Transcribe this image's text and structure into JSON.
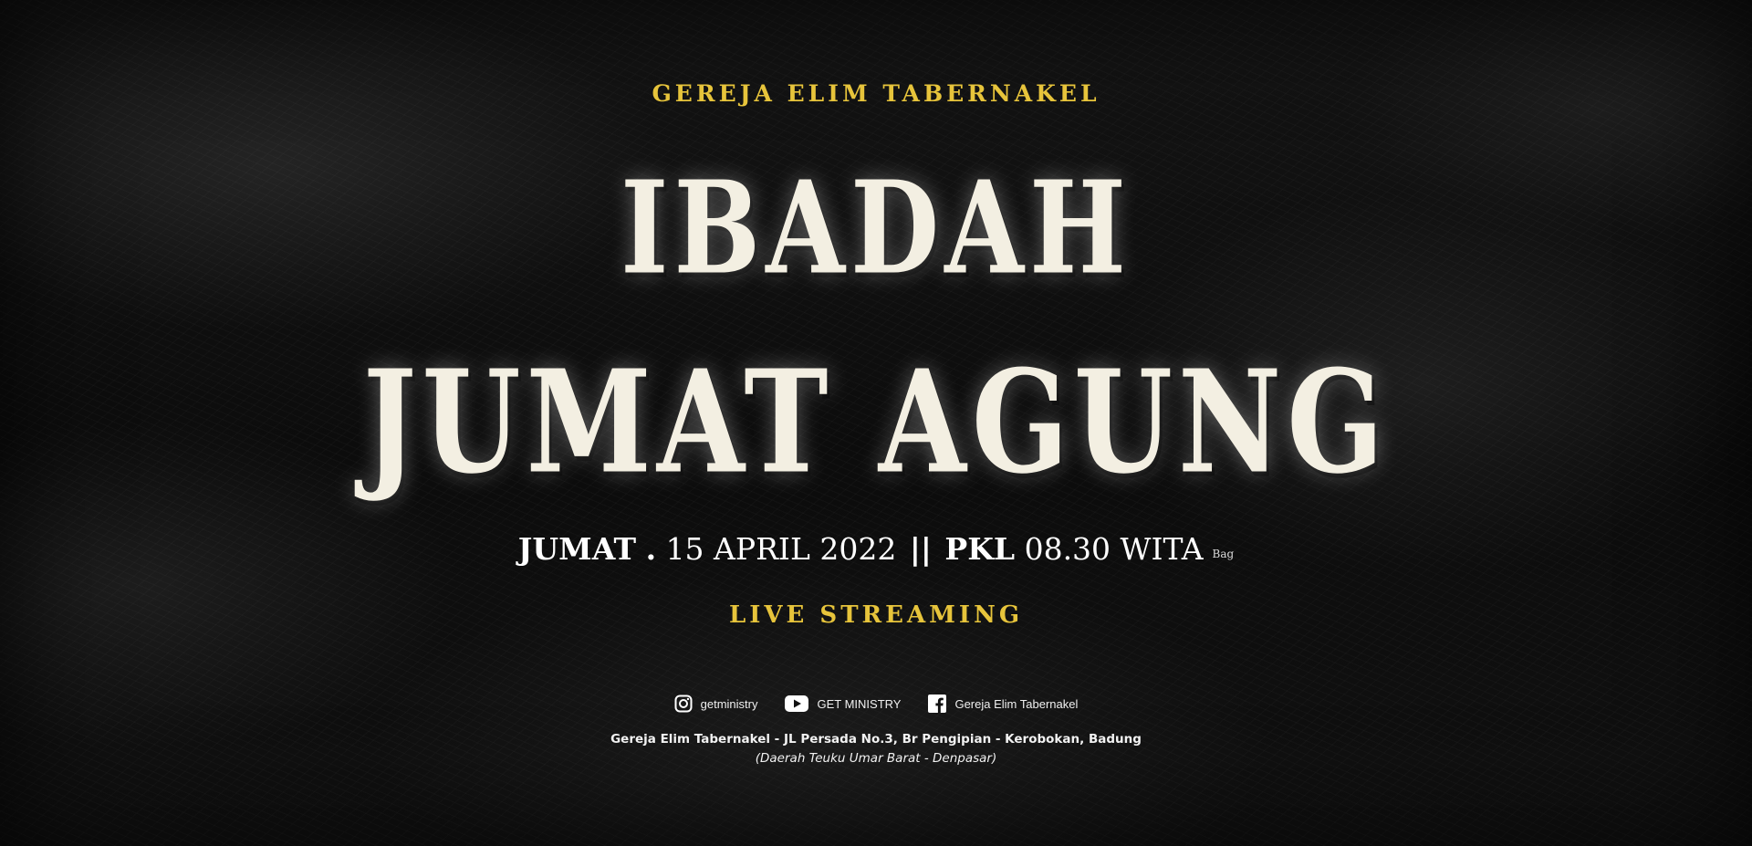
{
  "organization": "GEREJA ELIM TABERNAKEL",
  "title": {
    "line1": "IBADAH",
    "line2": "JUMAT AGUNG"
  },
  "schedule": {
    "day": "JUMAT",
    "dot": ".",
    "date": "15 APRIL 2022",
    "separator": "||",
    "pkl": "PKL",
    "time": "08.30 WITA",
    "suffix": "Bag"
  },
  "live_label": "LIVE STREAMING",
  "socials": [
    {
      "icon": "instagram-icon",
      "label": "getministry"
    },
    {
      "icon": "youtube-icon",
      "label": "GET MINISTRY"
    },
    {
      "icon": "facebook-icon",
      "label": "Gereja Elim Tabernakel"
    }
  ],
  "address": {
    "line1": "Gereja Elim Tabernakel - JL Persada No.3, Br Pengipian - Kerobokan, Badung",
    "line2": "(Daerah Teuku Umar Barat - Denpasar)"
  },
  "colors": {
    "accent": "#e7c43b",
    "title": "#f3efe2",
    "background": "#0f0f0f"
  }
}
